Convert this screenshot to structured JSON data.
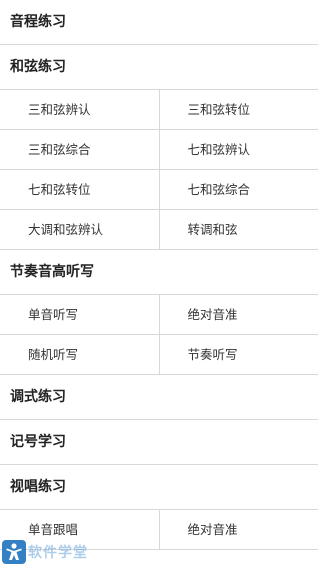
{
  "sections": [
    {
      "title": "音程练习",
      "rows": []
    },
    {
      "title": "和弦练习",
      "rows": [
        [
          "三和弦辨认",
          "三和弦转位"
        ],
        [
          "三和弦综合",
          "七和弦辨认"
        ],
        [
          "七和弦转位",
          "七和弦综合"
        ],
        [
          "大调和弦辨认",
          "转调和弦"
        ]
      ]
    },
    {
      "title": "节奏音高听写",
      "rows": [
        [
          "单音听写",
          "绝对音准"
        ],
        [
          "随机听写",
          "节奏听写"
        ]
      ]
    },
    {
      "title": "调式练习",
      "rows": []
    },
    {
      "title": "记号学习",
      "rows": []
    },
    {
      "title": "视唱练习",
      "rows": [
        [
          "单音跟唱",
          "绝对音准"
        ]
      ]
    }
  ],
  "watermark": {
    "text": "软件学堂",
    "icon": "person-logo-icon",
    "color": "#1e73be"
  }
}
